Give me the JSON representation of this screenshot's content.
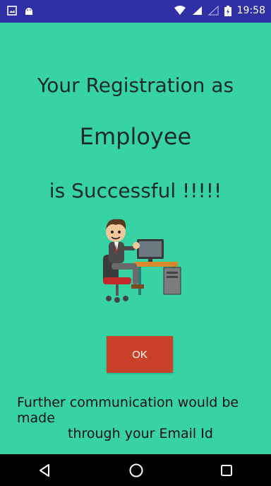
{
  "status_bar": {
    "time": "19:58",
    "icons": [
      "image-icon",
      "android-icon",
      "wifi-icon",
      "signal-icon",
      "signal-empty-icon",
      "battery-charging-icon"
    ]
  },
  "main": {
    "heading_line1": "Your Registration as",
    "heading_line2": "Employee",
    "heading_line3": "is Successful !!!!!",
    "illustration": "employee-at-computer-illustration",
    "ok_label": "OK",
    "message_line1": "Further communication would be made",
    "message_line2": "through your Email Id"
  },
  "nav_bar": {
    "buttons": [
      "back-icon",
      "home-icon",
      "recents-icon"
    ]
  },
  "colors": {
    "background": "#37d3a4",
    "status_bar": "#2f2fa6",
    "ok_button": "#c9402b",
    "nav_bar": "#000000"
  }
}
